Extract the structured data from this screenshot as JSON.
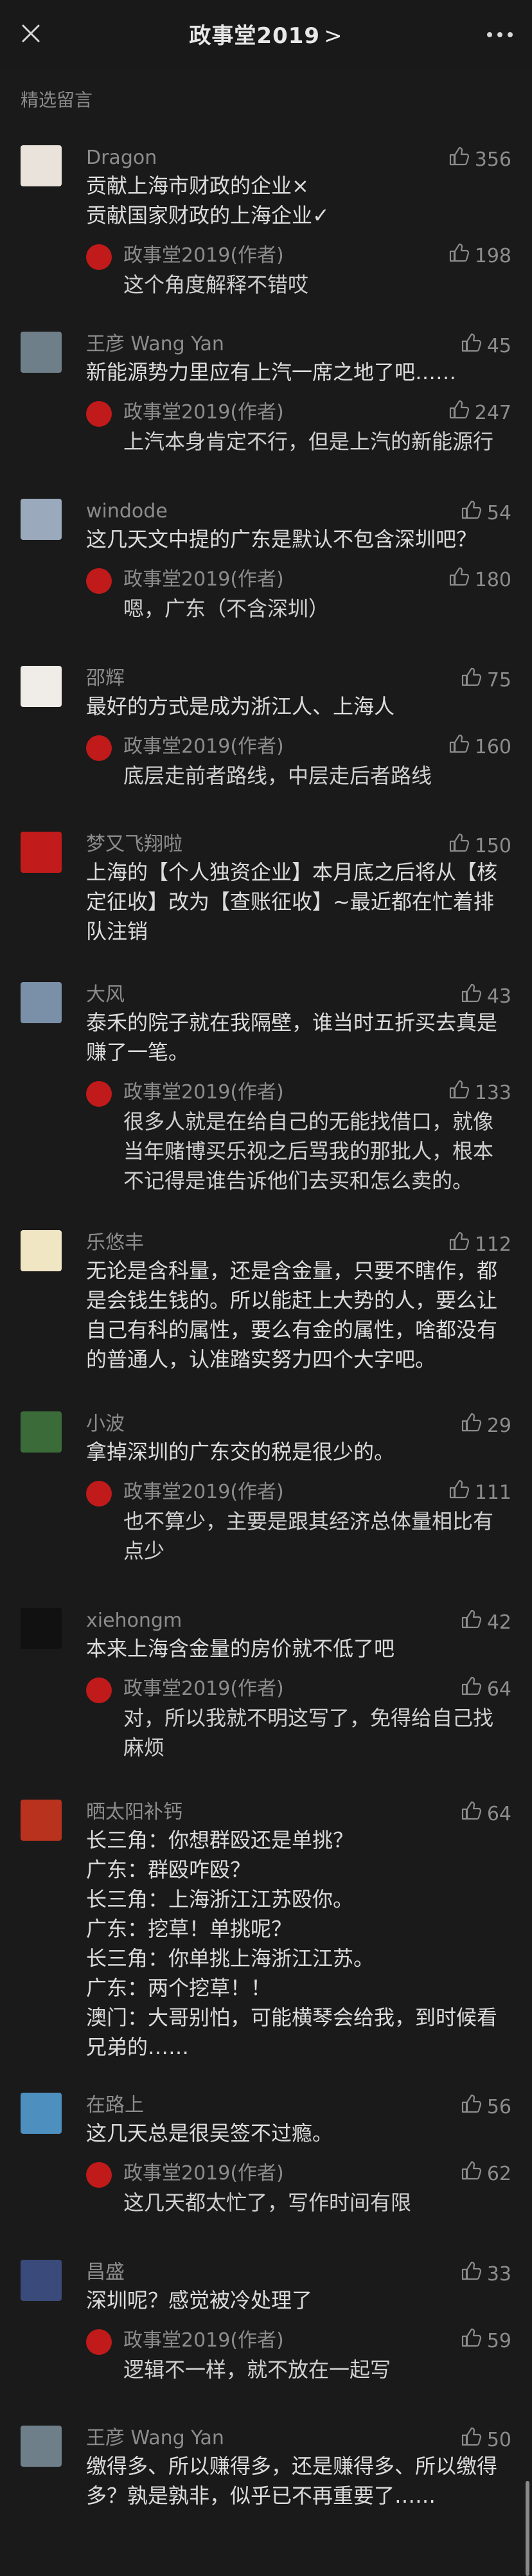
{
  "header": {
    "title": "政事堂2019",
    "chevron": ">"
  },
  "section_title": "精选留言",
  "comments": [
    {
      "name": "Dragon",
      "likes": "356",
      "lines": [
        "贡献上海市财政的企业×",
        "贡献国家财政的上海企业✓"
      ],
      "reply": {
        "name": "政事堂2019(作者)",
        "likes": "198",
        "lines": [
          "这个角度解释不错哎"
        ]
      }
    },
    {
      "name": "王彦 Wang Yan",
      "likes": "45",
      "lines": [
        "新能源势力里应有上汽一席之地了吧……"
      ],
      "reply": {
        "name": "政事堂2019(作者)",
        "likes": "247",
        "lines": [
          "上汽本身肯定不行，但是上汽的新能源行"
        ]
      }
    },
    {
      "name": "windode",
      "likes": "54",
      "lines": [
        "这几天文中提的广东是默认不包含深圳吧？"
      ],
      "reply": {
        "name": "政事堂2019(作者)",
        "likes": "180",
        "lines": [
          "嗯，广东（不含深圳）"
        ]
      }
    },
    {
      "name": "邵辉",
      "likes": "75",
      "lines": [
        "最好的方式是成为浙江人、上海人"
      ],
      "reply": {
        "name": "政事堂2019(作者)",
        "likes": "160",
        "lines": [
          "底层走前者路线，中层走后者路线"
        ]
      }
    },
    {
      "name": "梦又飞翔啦",
      "likes": "150",
      "lines": [
        "上海的【个人独资企业】本月底之后将从【核",
        "定征收】改为【查账征收】~最近都在忙着排",
        "队注销"
      ]
    },
    {
      "name": "大风",
      "likes": "43",
      "lines": [
        "泰禾的院子就在我隔壁，谁当时五折买去真是",
        "赚了一笔。"
      ],
      "reply": {
        "name": "政事堂2019(作者)",
        "likes": "133",
        "lines": [
          "很多人就是在给自己的无能找借口，就像",
          "当年赌博买乐视之后骂我的那批人，根本",
          "不记得是谁告诉他们去买和怎么卖的。"
        ]
      }
    },
    {
      "name": "乐悠丰",
      "likes": "112",
      "lines": [
        "无论是含科量，还是含金量，只要不瞎作，都",
        "是会钱生钱的。所以能赶上大势的人，要么让",
        "自己有科的属性，要么有金的属性，啥都没有",
        "的普通人，认准踏实努力四个大字吧。"
      ]
    },
    {
      "name": "小波",
      "likes": "29",
      "lines": [
        "拿掉深圳的广东交的税是很少的。"
      ],
      "reply": {
        "name": "政事堂2019(作者)",
        "likes": "111",
        "lines": [
          "也不算少，主要是跟其经济总体量相比有",
          "点少"
        ]
      }
    },
    {
      "name": "xiehongm",
      "likes": "42",
      "lines": [
        "本来上海含金量的房价就不低了吧"
      ],
      "reply": {
        "name": "政事堂2019(作者)",
        "likes": "64",
        "lines": [
          "对，所以我就不明这写了，免得给自己找",
          "麻烦"
        ]
      }
    },
    {
      "name": "晒太阳补钙",
      "likes": "64",
      "lines": [
        "长三角：你想群殴还是单挑？",
        "广东：群殴咋殴？",
        "长三角：上海浙江江苏殴你。",
        "广东：挖草！单挑呢？",
        "长三角：你单挑上海浙江江苏。",
        "广东：两个挖草！！",
        "澳门：大哥别怕，可能横琴会给我，到时候看",
        "兄弟的……"
      ]
    },
    {
      "name": "在路上",
      "likes": "56",
      "lines": [
        "这几天总是很吴签不过瘾。"
      ],
      "reply": {
        "name": "政事堂2019(作者)",
        "likes": "62",
        "lines": [
          "这几天都太忙了，写作时间有限"
        ]
      }
    },
    {
      "name": "昌盛",
      "likes": "33",
      "lines": [
        "深圳呢？感觉被冷处理了"
      ],
      "reply": {
        "name": "政事堂2019(作者)",
        "likes": "59",
        "lines": [
          "逻辑不一样，就不放在一起写"
        ]
      }
    },
    {
      "name": "王彦 Wang Yan",
      "likes": "50",
      "lines": [
        "缴得多、所以赚得多，还是赚得多、所以缴得",
        "多？孰是孰非，似乎已不再重要了……"
      ]
    }
  ]
}
